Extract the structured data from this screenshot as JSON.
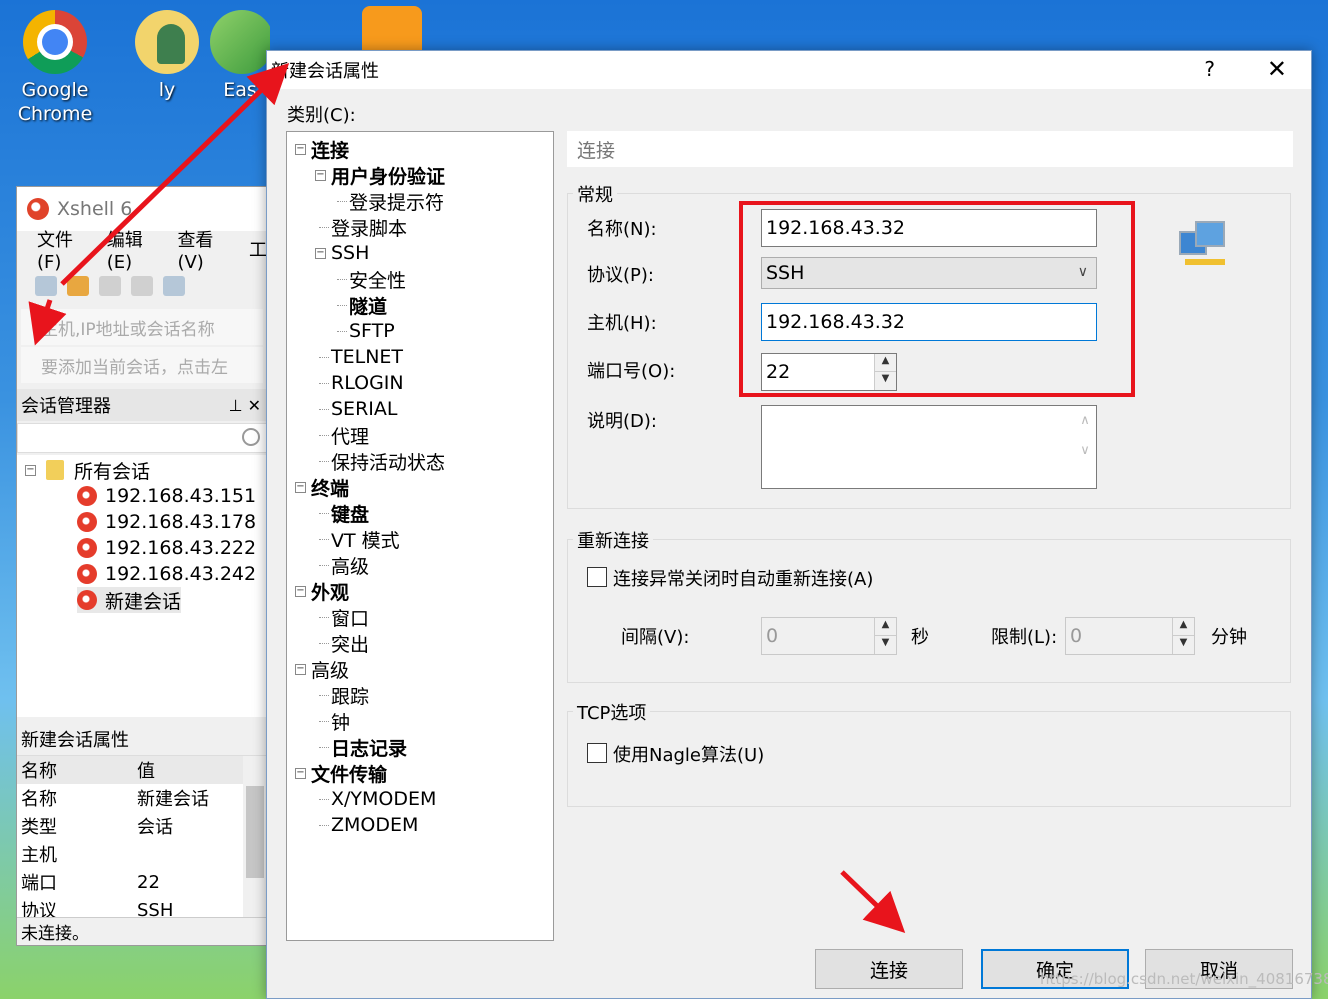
{
  "desktop": {
    "icons": [
      {
        "label_line1": "Google",
        "label_line2": "Chrome",
        "icon": "chrome-icon"
      },
      {
        "label_line1": "ly",
        "label_line2": "",
        "icon": "user-folder-icon"
      },
      {
        "label_line1": "Eas",
        "label_line2": "",
        "icon": "easy-app-icon"
      }
    ]
  },
  "xshell": {
    "title": "Xshell 6",
    "menu": [
      "文件(F)",
      "编辑(E)",
      "查看(V)",
      "工"
    ],
    "address_placeholder": "主机,IP地址或会话名称",
    "hint": "要添加当前会话，点击左",
    "session_manager": "会话管理器",
    "tree_root": "所有会话",
    "sessions": [
      "192.168.43.151",
      "192.168.43.178",
      "192.168.43.222",
      "192.168.43.242",
      "新建会话"
    ],
    "props_title": "新建会话属性",
    "props_headers": [
      "名称",
      "值"
    ],
    "props_rows": [
      [
        "名称",
        "新建会话"
      ],
      [
        "类型",
        "会话"
      ],
      [
        "主机",
        ""
      ],
      [
        "端口",
        "22"
      ],
      [
        "协议",
        "SSH"
      ]
    ],
    "status": "未连接。"
  },
  "dialog": {
    "title": "新建会话属性",
    "help": "?",
    "close": "✕",
    "category_label": "类别(C):",
    "tree": [
      {
        "label": "连接",
        "level": 0,
        "bold": true,
        "pm": "−"
      },
      {
        "label": "用户身份验证",
        "level": 1,
        "bold": true,
        "pm": "−"
      },
      {
        "label": "登录提示符",
        "level": 2,
        "bold": false,
        "pm": ""
      },
      {
        "label": "登录脚本",
        "level": 1,
        "bold": false,
        "pm": ""
      },
      {
        "label": "SSH",
        "level": 1,
        "bold": false,
        "pm": "−"
      },
      {
        "label": "安全性",
        "level": 2,
        "bold": false,
        "pm": ""
      },
      {
        "label": "隧道",
        "level": 2,
        "bold": true,
        "pm": ""
      },
      {
        "label": "SFTP",
        "level": 2,
        "bold": false,
        "pm": ""
      },
      {
        "label": "TELNET",
        "level": 1,
        "bold": false,
        "pm": ""
      },
      {
        "label": "RLOGIN",
        "level": 1,
        "bold": false,
        "pm": ""
      },
      {
        "label": "SERIAL",
        "level": 1,
        "bold": false,
        "pm": ""
      },
      {
        "label": "代理",
        "level": 1,
        "bold": false,
        "pm": ""
      },
      {
        "label": "保持活动状态",
        "level": 1,
        "bold": false,
        "pm": ""
      },
      {
        "label": "终端",
        "level": 0,
        "bold": true,
        "pm": "−"
      },
      {
        "label": "键盘",
        "level": 1,
        "bold": true,
        "pm": ""
      },
      {
        "label": "VT 模式",
        "level": 1,
        "bold": false,
        "pm": ""
      },
      {
        "label": "高级",
        "level": 1,
        "bold": false,
        "pm": ""
      },
      {
        "label": "外观",
        "level": 0,
        "bold": true,
        "pm": "−"
      },
      {
        "label": "窗口",
        "level": 1,
        "bold": false,
        "pm": ""
      },
      {
        "label": "突出",
        "level": 1,
        "bold": false,
        "pm": ""
      },
      {
        "label": "高级",
        "level": 0,
        "bold": false,
        "pm": "−"
      },
      {
        "label": "跟踪",
        "level": 1,
        "bold": false,
        "pm": ""
      },
      {
        "label": "钟",
        "level": 1,
        "bold": false,
        "pm": ""
      },
      {
        "label": "日志记录",
        "level": 1,
        "bold": true,
        "pm": ""
      },
      {
        "label": "文件传输",
        "level": 0,
        "bold": true,
        "pm": "−"
      },
      {
        "label": "X/YMODEM",
        "level": 1,
        "bold": false,
        "pm": ""
      },
      {
        "label": "ZMODEM",
        "level": 1,
        "bold": false,
        "pm": ""
      }
    ],
    "panel_title": "连接",
    "general": {
      "label": "常规",
      "name_label": "名称(N):",
      "name_value": "192.168.43.32",
      "protocol_label": "协议(P):",
      "protocol_value": "SSH",
      "host_label": "主机(H):",
      "host_value": "192.168.43.32",
      "port_label": "端口号(O):",
      "port_value": "22",
      "desc_label": "说明(D):",
      "desc_value": ""
    },
    "reconnect": {
      "label": "重新连接",
      "auto_label": "连接异常关闭时自动重新连接(A)",
      "interval_label": "间隔(V):",
      "interval_value": "0",
      "sec_unit": "秒",
      "limit_label": "限制(L):",
      "limit_value": "0",
      "min_unit": "分钟"
    },
    "tcp": {
      "label": "TCP选项",
      "nagle_label": "使用Nagle算法(U)"
    },
    "buttons": {
      "connect": "连接",
      "ok": "确定",
      "cancel": "取消"
    }
  },
  "watermark": "https://blog.csdn.net/weixin_40816738",
  "colors": {
    "highlight": "#e8141c",
    "focus": "#0078d7"
  }
}
